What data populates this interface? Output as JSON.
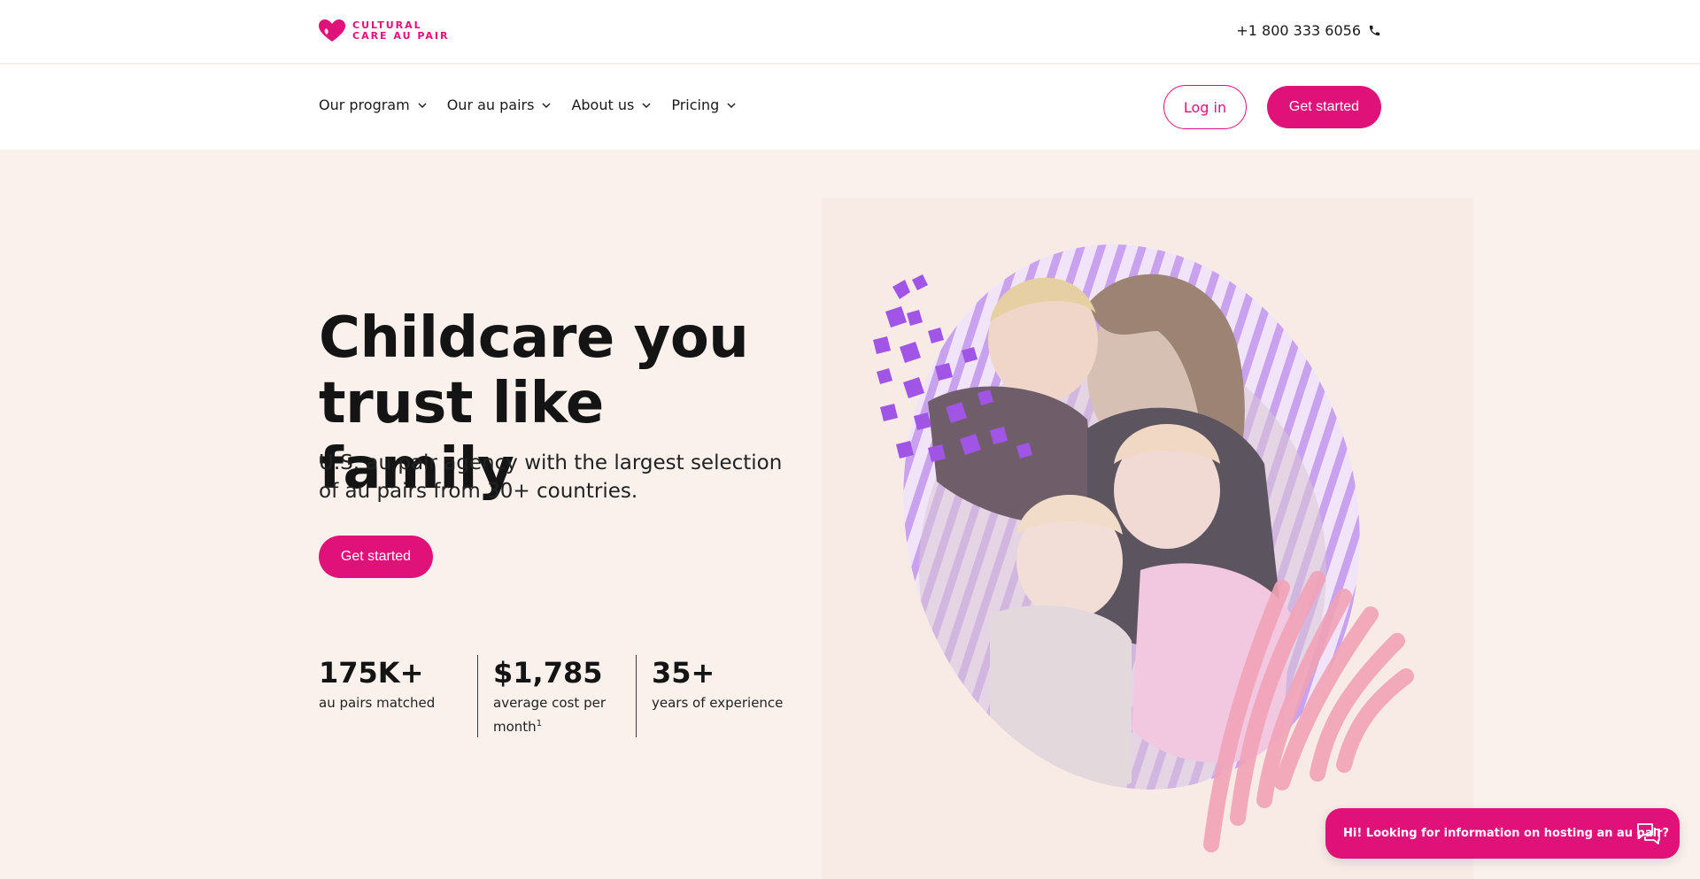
{
  "brand": {
    "logo_line1": "CULTURAL",
    "logo_line2": "CARE AU PAIR",
    "logo_icon": "heart-logo-icon",
    "accent_color": "#e0127a",
    "background_color": "#fbf1ec"
  },
  "topbar": {
    "phone": "+1 800 333 6056",
    "phone_icon": "phone-icon"
  },
  "nav": {
    "items": [
      {
        "label": "Our program"
      },
      {
        "label": "Our au pairs"
      },
      {
        "label": "About us"
      },
      {
        "label": "Pricing"
      }
    ],
    "login_label": "Log in",
    "get_started_label": "Get started"
  },
  "hero": {
    "title": "Childcare you trust like family",
    "subtitle": "U.S. au pair agency with the largest selection of au pairs from 30+ countries.",
    "cta_label": "Get started"
  },
  "stats": [
    {
      "value": "175K+",
      "label": "au pairs matched",
      "footnote": ""
    },
    {
      "value": "$1,785",
      "label": "average cost per month",
      "footnote": "1"
    },
    {
      "value": "35+",
      "label": "years of experience",
      "footnote": ""
    }
  ],
  "chat": {
    "text": "Hi! Looking for information on hosting an au pair?",
    "icon": "chat-bubbles-icon"
  }
}
